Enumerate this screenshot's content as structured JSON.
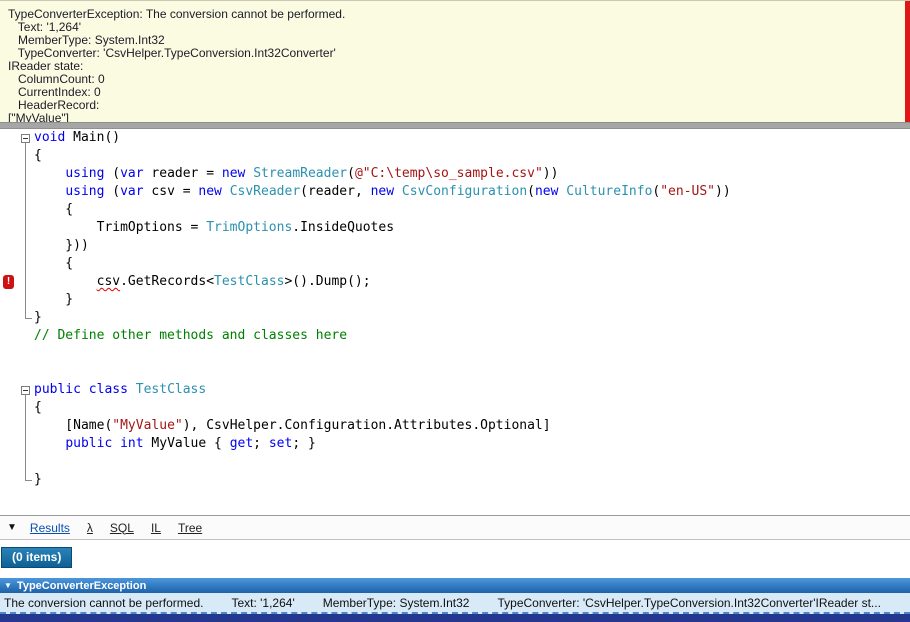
{
  "colors": {
    "kw": "#0000ee",
    "typ": "#2b91af",
    "str": "#a31515",
    "com": "#008000",
    "panel-yellow": "#fbfbe2",
    "stripe-red": "#e01717",
    "bottom-bar": "#24388f"
  },
  "exception_panel": {
    "lines": [
      "TypeConverterException: The conversion cannot be performed.",
      "   Text: '1,264'",
      "   MemberType: System.Int32",
      "   TypeConverter: 'CsvHelper.TypeConversion.Int32Converter'",
      "IReader state:",
      "   ColumnCount: 0",
      "   CurrentIndex: 0",
      "   HeaderRecord:",
      "[\"MyValue\"]"
    ]
  },
  "editor": {
    "error_marker_line": 8,
    "error_marker_glyph": "!",
    "fold_regions": [
      {
        "start": 0,
        "end": 10
      },
      {
        "start": 14,
        "end": 19
      }
    ],
    "lines": [
      {
        "tokens": [
          {
            "t": "kw",
            "s": "void"
          },
          {
            "t": "pl",
            "s": " Main()"
          }
        ]
      },
      {
        "tokens": [
          {
            "t": "pl",
            "s": "{"
          }
        ]
      },
      {
        "tokens": [
          {
            "t": "pl",
            "s": "    "
          },
          {
            "t": "kw",
            "s": "using"
          },
          {
            "t": "pl",
            "s": " ("
          },
          {
            "t": "kw",
            "s": "var"
          },
          {
            "t": "pl",
            "s": " reader = "
          },
          {
            "t": "kw",
            "s": "new"
          },
          {
            "t": "pl",
            "s": " "
          },
          {
            "t": "typ",
            "s": "StreamReader"
          },
          {
            "t": "pl",
            "s": "("
          },
          {
            "t": "str",
            "s": "@\"C:\\temp\\so_sample.csv\""
          },
          {
            "t": "pl",
            "s": "))"
          }
        ]
      },
      {
        "tokens": [
          {
            "t": "pl",
            "s": "    "
          },
          {
            "t": "kw",
            "s": "using"
          },
          {
            "t": "pl",
            "s": " ("
          },
          {
            "t": "kw",
            "s": "var"
          },
          {
            "t": "pl",
            "s": " csv = "
          },
          {
            "t": "kw",
            "s": "new"
          },
          {
            "t": "pl",
            "s": " "
          },
          {
            "t": "typ",
            "s": "CsvReader"
          },
          {
            "t": "pl",
            "s": "(reader, "
          },
          {
            "t": "kw",
            "s": "new"
          },
          {
            "t": "pl",
            "s": " "
          },
          {
            "t": "typ",
            "s": "CsvConfiguration"
          },
          {
            "t": "pl",
            "s": "("
          },
          {
            "t": "kw",
            "s": "new"
          },
          {
            "t": "pl",
            "s": " "
          },
          {
            "t": "typ",
            "s": "CultureInfo"
          },
          {
            "t": "pl",
            "s": "("
          },
          {
            "t": "str",
            "s": "\"en-US\""
          },
          {
            "t": "pl",
            "s": "))"
          }
        ]
      },
      {
        "tokens": [
          {
            "t": "pl",
            "s": "    {"
          }
        ]
      },
      {
        "tokens": [
          {
            "t": "pl",
            "s": "        TrimOptions = "
          },
          {
            "t": "typ",
            "s": "TrimOptions"
          },
          {
            "t": "pl",
            "s": ".InsideQuotes"
          }
        ]
      },
      {
        "tokens": [
          {
            "t": "pl",
            "s": "    }))"
          }
        ]
      },
      {
        "tokens": [
          {
            "t": "pl",
            "s": "    {"
          }
        ]
      },
      {
        "tokens": [
          {
            "t": "pl",
            "s": "        "
          },
          {
            "t": "pl",
            "s": "csv",
            "error": true
          },
          {
            "t": "pl",
            "s": ".GetRecords<"
          },
          {
            "t": "typ",
            "s": "TestClass"
          },
          {
            "t": "pl",
            "s": ">().Dump();"
          }
        ]
      },
      {
        "tokens": [
          {
            "t": "pl",
            "s": "    }"
          }
        ]
      },
      {
        "tokens": [
          {
            "t": "pl",
            "s": "}"
          }
        ]
      },
      {
        "tokens": [
          {
            "t": "com",
            "s": "// Define other methods and classes here"
          }
        ]
      },
      {
        "tokens": []
      },
      {
        "tokens": []
      },
      {
        "tokens": [
          {
            "t": "kw",
            "s": "public"
          },
          {
            "t": "pl",
            "s": " "
          },
          {
            "t": "kw",
            "s": "class"
          },
          {
            "t": "pl",
            "s": " "
          },
          {
            "t": "typ",
            "s": "TestClass"
          }
        ]
      },
      {
        "tokens": [
          {
            "t": "pl",
            "s": "{"
          }
        ]
      },
      {
        "tokens": [
          {
            "t": "pl",
            "s": "    [Name("
          },
          {
            "t": "str",
            "s": "\"MyValue\""
          },
          {
            "t": "pl",
            "s": "), CsvHelper.Configuration.Attributes.Optional]"
          }
        ]
      },
      {
        "tokens": [
          {
            "t": "pl",
            "s": "    "
          },
          {
            "t": "kw",
            "s": "public"
          },
          {
            "t": "pl",
            "s": " "
          },
          {
            "t": "kw",
            "s": "int"
          },
          {
            "t": "pl",
            "s": " MyValue { "
          },
          {
            "t": "kw",
            "s": "get"
          },
          {
            "t": "pl",
            "s": "; "
          },
          {
            "t": "kw",
            "s": "set"
          },
          {
            "t": "pl",
            "s": "; }"
          }
        ]
      },
      {
        "tokens": []
      },
      {
        "tokens": [
          {
            "t": "pl",
            "s": "}"
          }
        ]
      }
    ]
  },
  "tabbar": {
    "caret": "▼",
    "tabs": [
      {
        "id": "results",
        "label": "Results",
        "selected": true
      },
      {
        "id": "lambda",
        "label": "λ",
        "selected": false
      },
      {
        "id": "sql",
        "label": "SQL",
        "selected": false
      },
      {
        "id": "il",
        "label": "IL",
        "selected": false
      },
      {
        "id": "tree",
        "label": "Tree",
        "selected": false
      }
    ]
  },
  "results": {
    "items_badge": "(0 items)",
    "collapse_icon": "▼",
    "exception_title": "TypeConverterException",
    "detail_segments": [
      "The conversion cannot be performed.",
      "Text: '1,264'",
      "MemberType: System.Int32",
      "TypeConverter: 'CsvHelper.TypeConversion.Int32Converter'IReader st..."
    ]
  }
}
